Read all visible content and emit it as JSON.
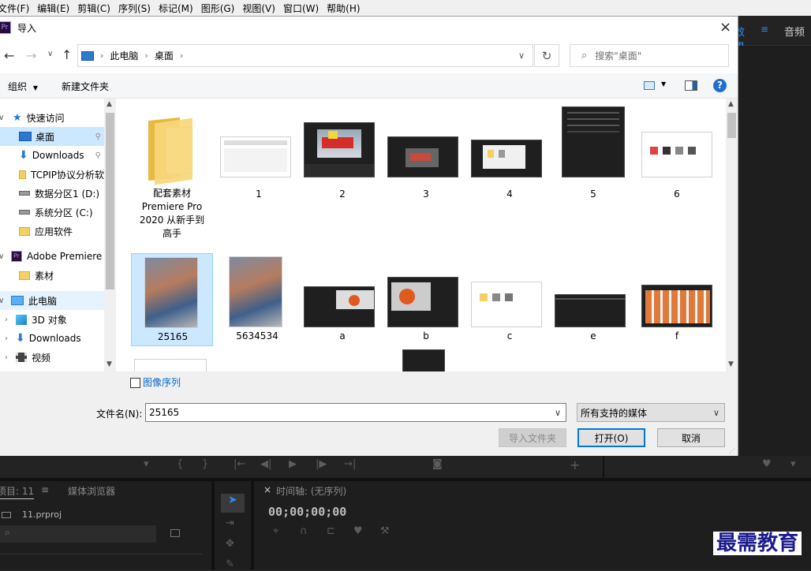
{
  "menubar": {
    "items": [
      "文件(F)",
      "编辑(E)",
      "剪辑(C)",
      "序列(S)",
      "标记(M)",
      "图形(G)",
      "视图(V)",
      "窗口(W)",
      "帮助(H)"
    ]
  },
  "premiere": {
    "right_tabs": [
      "效果",
      "音频"
    ],
    "project_tab": "项目: 11",
    "media_browser_tab": "媒体浏览器",
    "project_file": "11.prproj",
    "timeline_tab": "时间轴: (无序列)",
    "timecode": "00;00;00;00",
    "watermark": "最需教育"
  },
  "dialog": {
    "title": "导入",
    "app_icon": "Pr",
    "breadcrumb": [
      "此电脑",
      "桌面"
    ],
    "search_placeholder": "搜索\"桌面\"",
    "toolbar": {
      "organize": "组织",
      "new_folder": "新建文件夹"
    },
    "sidebar": [
      {
        "label": "快速访问",
        "icon": "star-icon",
        "level": 0
      },
      {
        "label": "桌面",
        "icon": "desktop-icon",
        "level": 1,
        "selected": true
      },
      {
        "label": "Downloads",
        "icon": "download-icon",
        "level": 1
      },
      {
        "label": "TCPIP协议分析软",
        "icon": "folder-icon",
        "level": 1
      },
      {
        "label": "数据分区1 (D:)",
        "icon": "drive-icon",
        "level": 1
      },
      {
        "label": "系统分区 (C:)",
        "icon": "drive-icon",
        "level": 1
      },
      {
        "label": "应用软件",
        "icon": "folder-icon",
        "level": 1
      },
      {
        "label": "Adobe Premiere",
        "icon": "premiere-icon",
        "level": 0
      },
      {
        "label": "素材",
        "icon": "folder-icon",
        "level": 1
      },
      {
        "label": "此电脑",
        "icon": "computer-icon",
        "level": 0
      },
      {
        "label": "3D 对象",
        "icon": "cube-icon",
        "level": 1
      },
      {
        "label": "Downloads",
        "icon": "download-icon",
        "level": 1
      },
      {
        "label": "视频",
        "icon": "video-icon",
        "level": 1
      }
    ],
    "files_row1": [
      {
        "name": "配套素材 Premiere Pro 2020 从新手到高手",
        "kind": "folder"
      },
      {
        "name": "1",
        "kind": "light"
      },
      {
        "name": "2",
        "kind": "boat"
      },
      {
        "name": "3",
        "kind": "dark"
      },
      {
        "name": "4",
        "kind": "dark"
      },
      {
        "name": "5",
        "kind": "tall-dark"
      },
      {
        "name": "6",
        "kind": "light"
      }
    ],
    "files_row2": [
      {
        "name": "25165",
        "kind": "photo",
        "selected": true
      },
      {
        "name": "5634534",
        "kind": "photo"
      },
      {
        "name": "a",
        "kind": "tomato"
      },
      {
        "name": "b",
        "kind": "tomato"
      },
      {
        "name": "c",
        "kind": "light"
      },
      {
        "name": "e",
        "kind": "dark"
      },
      {
        "name": "f",
        "kind": "grid"
      }
    ],
    "image_sequence_label": "图像序列",
    "filename_label": "文件名(N):",
    "filename_value": "25165",
    "filetype_value": "所有支持的媒体",
    "import_folder_btn": "导入文件夹",
    "open_btn": "打开(O)",
    "cancel_btn": "取消"
  }
}
